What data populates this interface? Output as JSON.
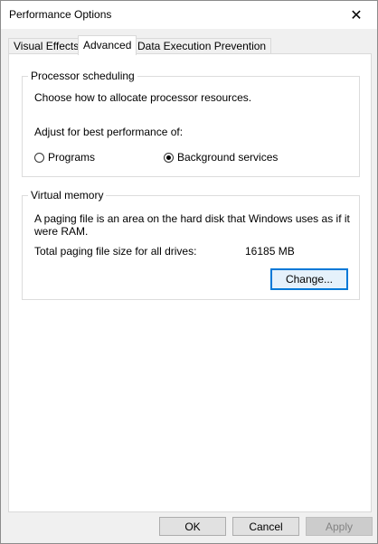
{
  "window": {
    "title": "Performance Options",
    "close_glyph": "✕"
  },
  "tabs": [
    {
      "label": "Visual Effects"
    },
    {
      "label": "Advanced"
    },
    {
      "label": "Data Execution Prevention"
    }
  ],
  "processor": {
    "legend": "Processor scheduling",
    "description": "Choose how to allocate processor resources.",
    "adjust_label": "Adjust for best performance of:",
    "options": [
      {
        "label": "Programs",
        "checked": false
      },
      {
        "label": "Background services",
        "checked": true
      }
    ]
  },
  "virtual_memory": {
    "legend": "Virtual memory",
    "description": "A paging file is an area on the hard disk that Windows uses as if it were RAM.",
    "total_label": "Total paging file size for all drives:",
    "total_value": "16185 MB",
    "change_label": "Change..."
  },
  "footer": {
    "ok_label": "OK",
    "cancel_label": "Cancel",
    "apply_label": "Apply"
  }
}
